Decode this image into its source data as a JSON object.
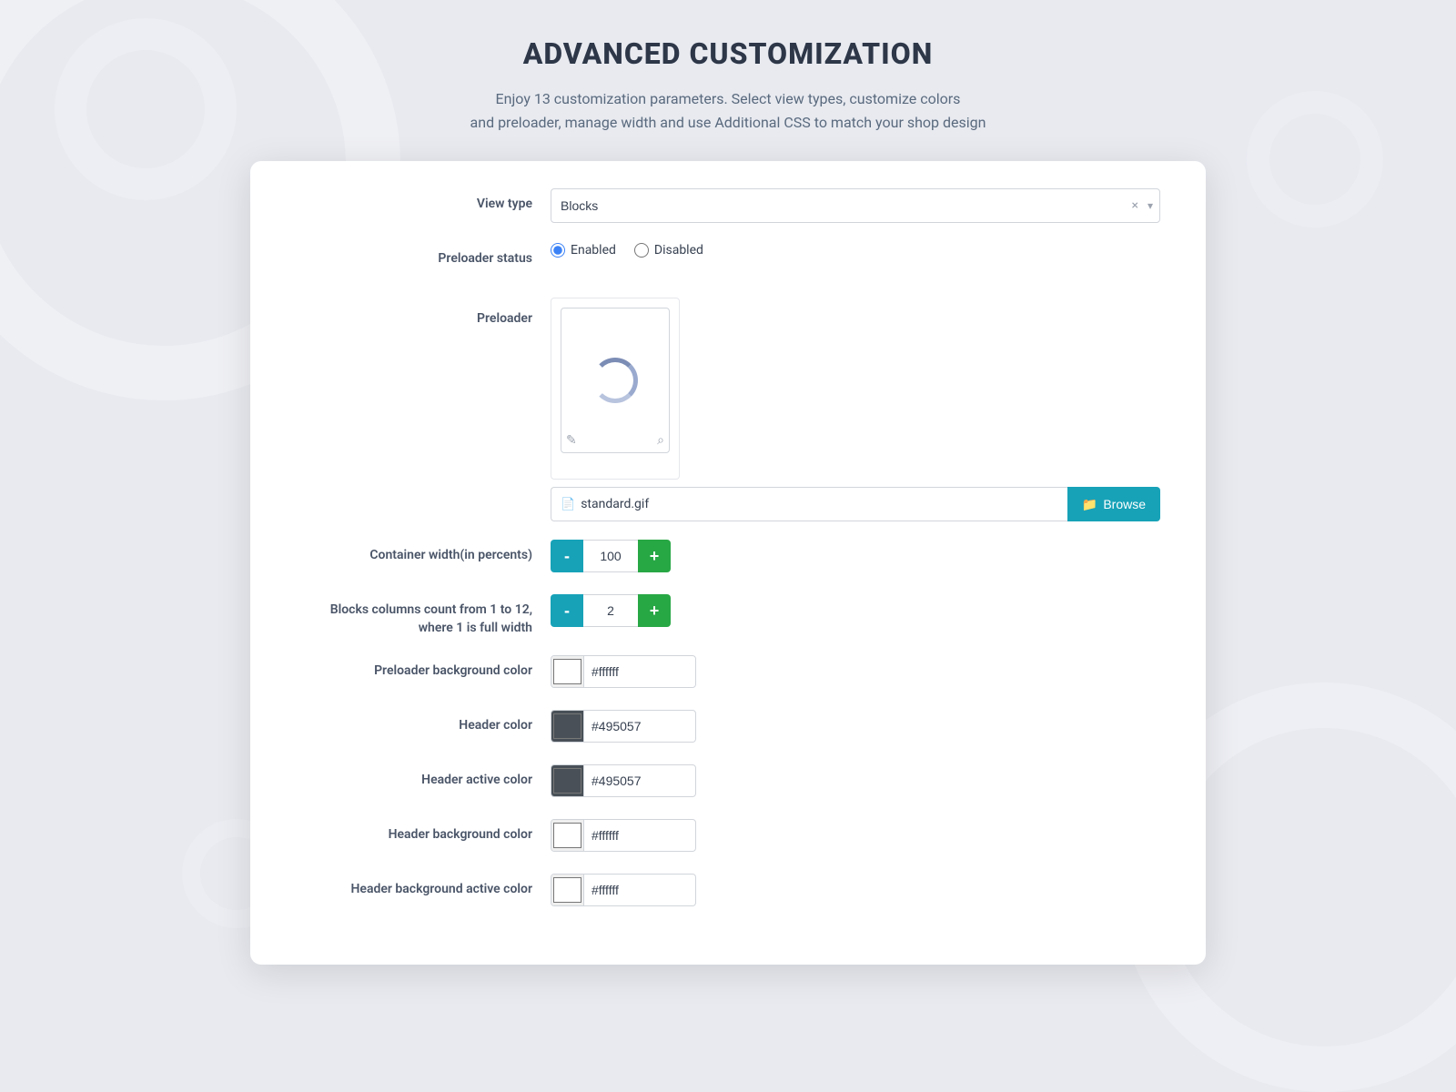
{
  "page": {
    "title": "ADVANCED CUSTOMIZATION",
    "subtitle_line1": "Enjoy 13 customization parameters. Select view types, customize colors",
    "subtitle_line2": "and preloader, manage width and use Additional CSS to match your shop design"
  },
  "form": {
    "view_type": {
      "label": "View type",
      "value": "Blocks",
      "clear_symbol": "×",
      "arrow_symbol": "▾"
    },
    "preloader_status": {
      "label": "Preloader status",
      "enabled_label": "Enabled",
      "disabled_label": "Disabled",
      "selected": "enabled"
    },
    "preloader": {
      "label": "Preloader",
      "close_symbol": "×",
      "zoom_symbol": "⊕",
      "edit_symbol": "✎"
    },
    "file_input": {
      "filename": "standard.gif",
      "browse_label": "Browse",
      "browse_icon": "📁"
    },
    "container_width": {
      "label": "Container width(in percents)",
      "value": "100",
      "minus_label": "-",
      "plus_label": "+"
    },
    "blocks_columns": {
      "label": "Blocks columns count from 1 to 12, where 1 is full width",
      "value": "2",
      "minus_label": "-",
      "plus_label": "+"
    },
    "preloader_bg_color": {
      "label": "Preloader background color",
      "value": "#ffffff",
      "swatch_color": "#ffffff"
    },
    "header_color": {
      "label": "Header color",
      "value": "#495057",
      "swatch_color": "#495057"
    },
    "header_active_color": {
      "label": "Header active color",
      "value": "#495057",
      "swatch_color": "#495057"
    },
    "header_bg_color": {
      "label": "Header background color",
      "value": "#ffffff",
      "swatch_color": "#ffffff"
    },
    "header_bg_active_color": {
      "label": "Header background active color",
      "value": "#ffffff",
      "swatch_color": "#ffffff"
    }
  },
  "colors": {
    "browse_button": "#17a2b8",
    "minus_button": "#17a2b8",
    "plus_button": "#28a745"
  }
}
